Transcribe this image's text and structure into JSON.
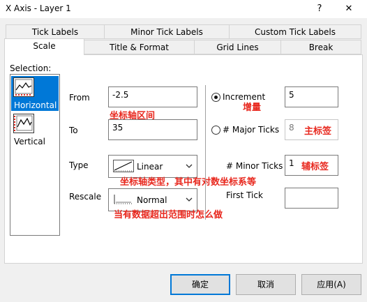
{
  "window": {
    "title": "X Axis - Layer 1",
    "help": "?",
    "close": "✕"
  },
  "tabs": {
    "row1": [
      "Tick Labels",
      "Minor Tick Labels",
      "Custom Tick Labels"
    ],
    "row2": [
      "Scale",
      "Title & Format",
      "Grid Lines",
      "Break"
    ],
    "active": "Scale"
  },
  "selection": {
    "label": "Selection:",
    "items": [
      "Horizontal",
      "Vertical"
    ],
    "selected": "Horizontal"
  },
  "scale": {
    "from_label": "From",
    "from_value": "-2.5",
    "to_label": "To",
    "to_value": "35",
    "type_label": "Type",
    "type_value": "Linear",
    "rescale_label": "Rescale",
    "rescale_value": "Normal"
  },
  "ticks": {
    "increment_label": "Increment",
    "increment_value": "5",
    "major_label": "# Major Ticks",
    "major_value": "8",
    "minor_label": "# Minor Ticks",
    "minor_value": "1",
    "first_label": "First Tick",
    "first_value": ""
  },
  "annotations": {
    "range": "坐标轴区间",
    "increment": "增量",
    "major": "主标签",
    "minor": "辅标签",
    "type": "坐标轴类型，其中有对数坐标系等",
    "rescale": "当有数据超出范围时怎么做"
  },
  "buttons": {
    "ok": "确定",
    "cancel": "取消",
    "apply": "应用(A)"
  },
  "colors": {
    "accent": "#0078d7",
    "annotation": "#e8281e"
  }
}
